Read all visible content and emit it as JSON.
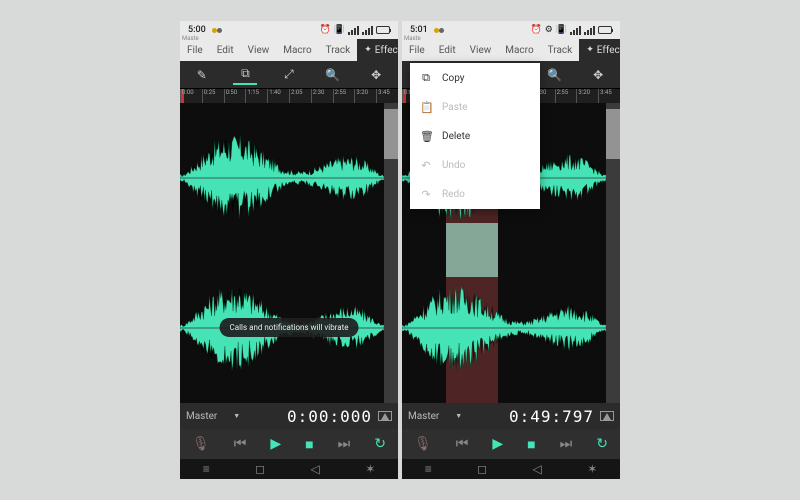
{
  "statusbar": {
    "left_time": "5:00",
    "right_time": "5:01"
  },
  "menubar": {
    "items": [
      "File",
      "Edit",
      "View",
      "Macro",
      "Track",
      "Effects"
    ],
    "active_index": 5
  },
  "toolbar": {
    "icons": [
      "pencil-icon",
      "crop-icon",
      "zoom-out-icon",
      "zoom-in-icon",
      "move-icon"
    ],
    "active_index": 1
  },
  "ruler": {
    "ticks": [
      "0:00",
      "0:25",
      "0:50",
      "1:15",
      "1:40",
      "2:05",
      "2:30",
      "2:55",
      "3:20",
      "3:45"
    ],
    "track_label": "Maste"
  },
  "toast": {
    "text": "Calls and notifications will vibrate"
  },
  "context_menu": {
    "items": [
      {
        "icon": "copy-icon",
        "label": "Copy",
        "enabled": true
      },
      {
        "icon": "clipboard-icon",
        "label": "Paste",
        "enabled": false
      },
      {
        "icon": "trash-icon",
        "label": "Delete",
        "enabled": true
      },
      {
        "icon": "undo-icon",
        "label": "Undo",
        "enabled": false
      },
      {
        "icon": "redo-icon",
        "label": "Redo",
        "enabled": false
      }
    ]
  },
  "bottom": {
    "dropdown_label": "Master",
    "time_left": "0:00:000",
    "time_right": "0:49:797"
  },
  "transport": {
    "icons": [
      "mic-icon",
      "skip-start-icon",
      "play-icon",
      "stop-icon",
      "skip-end-icon",
      "loop-icon"
    ]
  },
  "selection": {
    "start_pct": 20,
    "width_pct": 24
  },
  "colors": {
    "accent": "#46e3b7"
  }
}
